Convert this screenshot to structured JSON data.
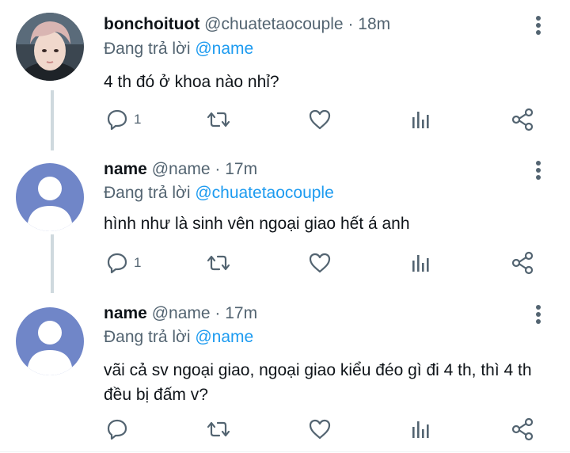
{
  "tweets": [
    {
      "name": "bonchoituot",
      "handle": "@chuatetaocouple",
      "dot": "·",
      "time": "18m",
      "reply_prefix": "Đang trả lời",
      "reply_to": "@name",
      "text": "4 th đó ở khoa nào nhỉ?",
      "reply_count": "1",
      "avatar": "photo"
    },
    {
      "name": "name",
      "handle": "@name",
      "dot": "·",
      "time": "17m",
      "reply_prefix": "Đang trả lời",
      "reply_to": "@chuatetaocouple",
      "text": "hình như là sinh vên ngoại giao hết á anh",
      "reply_count": "1",
      "avatar": "default"
    },
    {
      "name": "name",
      "handle": "@name",
      "dot": "·",
      "time": "17m",
      "reply_prefix": "Đang trả lời",
      "reply_to": "@name",
      "text": "vãi cả sv ngoại giao, ngoại giao kiểu đéo gì đi 4 th, thì 4 th đều bị đấm v?",
      "reply_count": "",
      "avatar": "default"
    }
  ],
  "icons": {
    "reply": "speech-bubble-icon",
    "retweet": "retweet-icon",
    "like": "heart-icon",
    "views": "bar-chart-icon",
    "share": "share-icon",
    "more": "more-vertical-icon"
  },
  "colors": {
    "link": "#1d9bf0",
    "secondary_text": "#536471",
    "thread_line": "#cfd9de",
    "default_avatar_bg": "#7086c8"
  }
}
